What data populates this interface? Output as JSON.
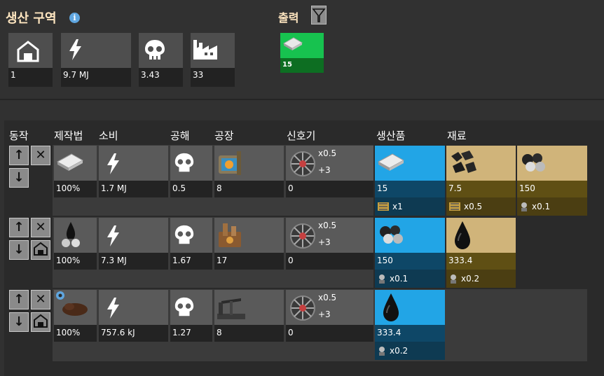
{
  "header": {
    "title": "생산 구역",
    "info": "i",
    "output_title": "출력"
  },
  "summary": [
    {
      "icon": "home-icon",
      "value": "1"
    },
    {
      "icon": "lightning-icon",
      "value": "9.7 MJ"
    },
    {
      "icon": "skull-icon",
      "value": "3.43"
    },
    {
      "icon": "factory-icon",
      "value": "33"
    }
  ],
  "output": {
    "icon": "iron-plate-icon",
    "value": "15"
  },
  "columns": {
    "action": "동작",
    "recipe": "제작법",
    "power": "소비",
    "pollution": "공해",
    "factory": "공장",
    "beacon": "신호기",
    "products": "생산품",
    "ingredients": "재료"
  },
  "rows": [
    {
      "recipe_pct": "100%",
      "power": "1.7 MJ",
      "pollution": "0.5",
      "factory_count": "8",
      "beacon": {
        "count": "0",
        "mult": "x0.5",
        "plus": "+3"
      },
      "products": [
        {
          "value": "15",
          "belt_text": "x1"
        }
      ],
      "ingredients": [
        {
          "value": "7.5",
          "belt_text": "x0.5"
        },
        {
          "value": "150",
          "belt_text": "x0.1"
        }
      ]
    },
    {
      "recipe_pct": "100%",
      "power": "7.3 MJ",
      "pollution": "1.67",
      "factory_count": "17",
      "beacon": {
        "count": "0",
        "mult": "x0.5",
        "plus": "+3"
      },
      "products": [
        {
          "value": "150",
          "belt_text": "x0.1"
        }
      ],
      "ingredients": [
        {
          "value": "333.4",
          "belt_text": "x0.2"
        }
      ]
    },
    {
      "recipe_pct": "100%",
      "power": "757.6 kJ",
      "pollution": "1.27",
      "factory_count": "8",
      "beacon": {
        "count": "0",
        "mult": "x0.5",
        "plus": "+3"
      },
      "products": [
        {
          "value": "333.4",
          "belt_text": "x0.2"
        }
      ],
      "ingredients": []
    }
  ],
  "colors": {
    "product": "#22a5e6",
    "ingredient": "#d0b47a",
    "output": "#17c24f"
  }
}
